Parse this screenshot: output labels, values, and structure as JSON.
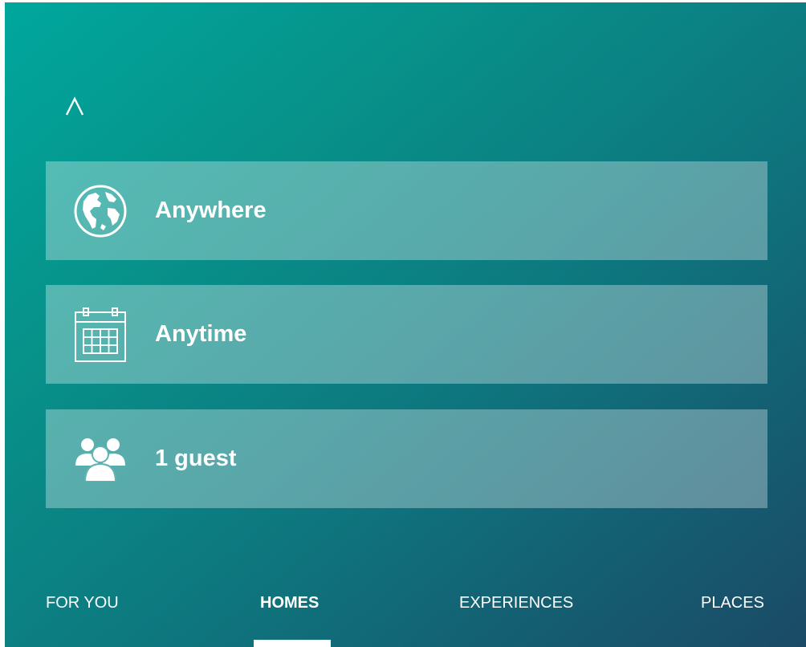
{
  "header": {
    "collapse_icon": "chevron-up-icon"
  },
  "search": {
    "fields": [
      {
        "icon": "globe-icon",
        "label": "Anywhere"
      },
      {
        "icon": "calendar-icon",
        "label": "Anytime"
      },
      {
        "icon": "guests-icon",
        "label": "1 guest"
      }
    ]
  },
  "tabs": [
    {
      "label": "FOR YOU",
      "active": false
    },
    {
      "label": "HOMES",
      "active": true
    },
    {
      "label": "EXPERIENCES",
      "active": false
    },
    {
      "label": "PLACES",
      "active": false
    }
  ],
  "colors": {
    "gradient_start": "#00a79d",
    "gradient_end": "#1b4a66",
    "field_overlay": "rgba(255,255,255,0.32)",
    "text": "#ffffff"
  }
}
